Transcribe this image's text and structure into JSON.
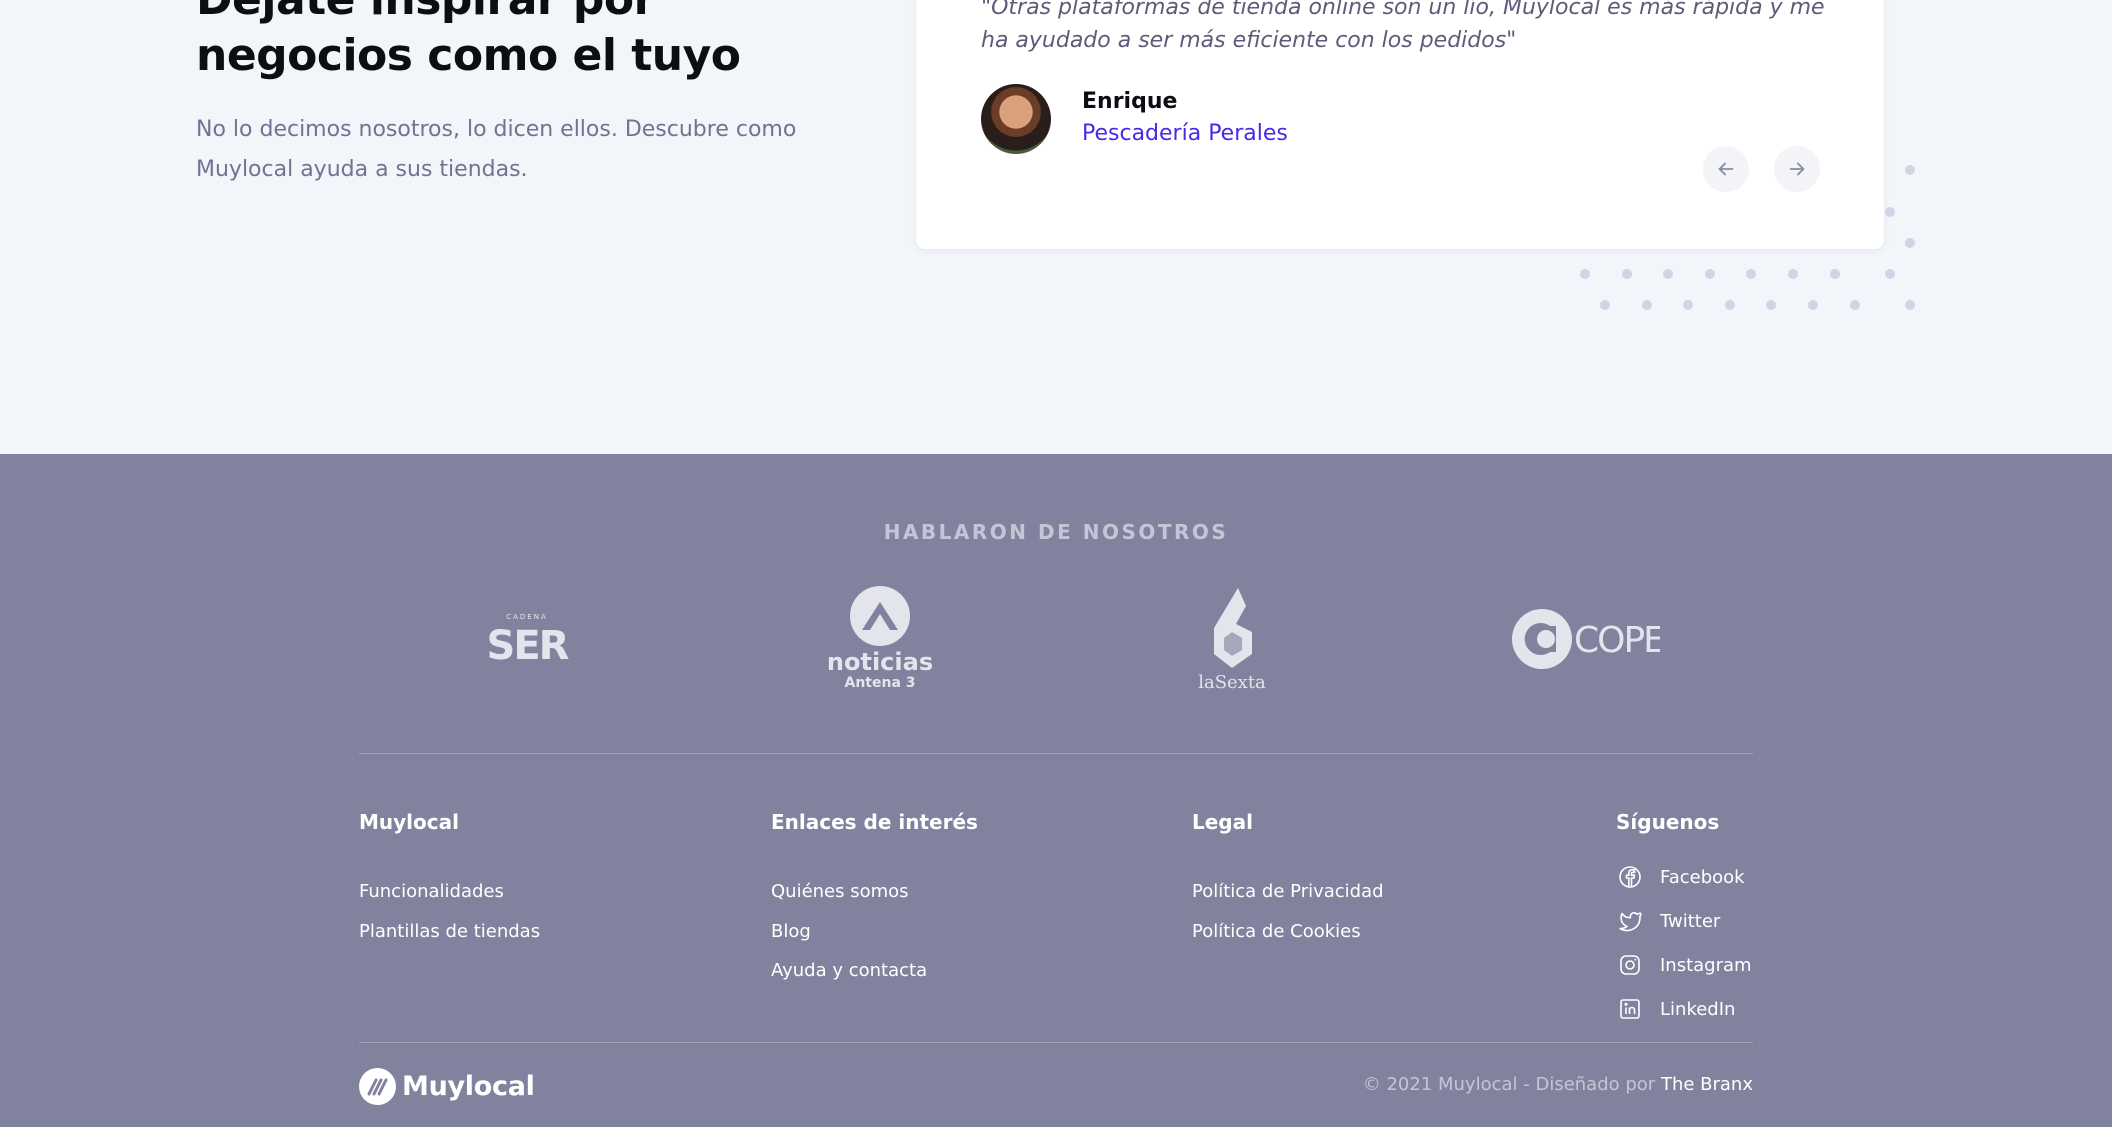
{
  "testimonials": {
    "headline": "Déjate inspirar por negocios como el tuyo",
    "subtext": "No lo decimos nosotros, lo dicen ellos. Descubre como Muylocal ayuda a sus tiendas.",
    "quote": "\"Otras plataformas de tienda online son un lío, Muylocal es más rápida y me ha ayudado a ser más eficiente con los pedidos\"",
    "author_name": "Enrique",
    "author_shop": "Pescadería Perales",
    "prev_icon": "arrow-left-icon",
    "next_icon": "arrow-right-icon"
  },
  "press": {
    "title": "HABLARON DE NOSOTROS",
    "logos": [
      {
        "name": "Cadena SER",
        "label": "SER",
        "sublabel": "CADENA"
      },
      {
        "name": "Noticias Antena 3",
        "label": "noticias",
        "sublabel": "Antena 3"
      },
      {
        "name": "laSexta",
        "label": "laSexta"
      },
      {
        "name": "COPE",
        "label": "COPE"
      }
    ]
  },
  "footer": {
    "columns": [
      {
        "title": "Muylocal",
        "links": [
          "Funcionalidades",
          "Plantillas de tiendas"
        ]
      },
      {
        "title": "Enlaces de interés",
        "links": [
          "Quiénes somos",
          "Blog",
          "Ayuda y contacta"
        ]
      },
      {
        "title": "Legal",
        "links": [
          "Política de Privacidad",
          "Política de Cookies"
        ]
      }
    ],
    "social": {
      "title": "Síguenos",
      "items": [
        {
          "label": "Facebook",
          "icon": "facebook-icon"
        },
        {
          "label": "Twitter",
          "icon": "twitter-icon"
        },
        {
          "label": "Instagram",
          "icon": "instagram-icon"
        },
        {
          "label": "LinkedIn",
          "icon": "linkedin-icon"
        }
      ]
    },
    "brand": "Muylocal",
    "copyright": "© 2021 Muylocal - Diseñado por",
    "credit": "The Branx"
  },
  "colors": {
    "accent": "#4a28ea",
    "footer_bg": "#81839e",
    "page_bg": "#f2f5f9"
  }
}
